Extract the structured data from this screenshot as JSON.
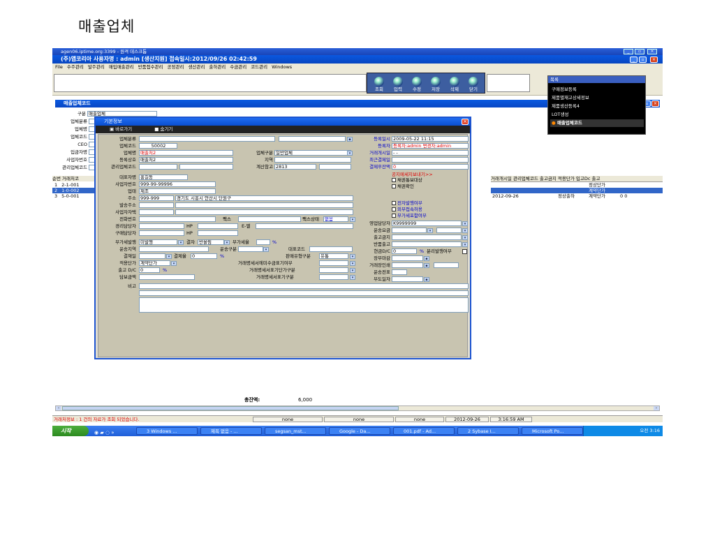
{
  "slide_title": "매출업체",
  "remote_title": "agen06.iptime.org:3399 - 원격 데스크톱",
  "app": {
    "title": "(주)앱코리아  사용자명 : admin [생산지원]   접속일시:2012/09/26  02:42:59",
    "menu": [
      "File",
      "수주관리",
      "발주관리",
      "매입매출관리",
      "반품접수관리",
      "공정관리",
      "생산관리",
      "출하관리",
      "수금관리",
      "코드관리",
      "Windows"
    ],
    "toolbar": [
      "조회",
      "입력",
      "수정",
      "저장",
      "삭제",
      "닫기"
    ]
  },
  "main_window": {
    "title": "매출업체코드",
    "search_label": "구분",
    "search_value": "매출업체",
    "filter_labels": [
      "업체분류",
      "업체명",
      "업체코드",
      "CEO",
      "입금자명",
      "사업자번호",
      "관리업체코드"
    ],
    "grid_header": "순번 거래처코",
    "rows": [
      {
        "no": "1",
        "code": "2-1-001"
      },
      {
        "no": "2",
        "code": "1-0-002"
      },
      {
        "no": "3",
        "code": "5-0-001"
      }
    ],
    "right_headers": "거래개시일 관리업체코드 출고금지   적용단가  입고Dc  출고",
    "right_rows": [
      {
        "date": "",
        "status": "",
        "price": "정상단가",
        "dc": ""
      },
      {
        "date": "",
        "status": "",
        "price": "계약단가",
        "dc": ""
      },
      {
        "date": "2012-09-26",
        "status": "정상출하",
        "price": "계약단가",
        "dc": "0     0"
      }
    ],
    "total_label": "총잔액:",
    "total_value": "6,000"
  },
  "dialog": {
    "title": "기본정보",
    "tools": [
      "바로가기",
      "숨기기"
    ],
    "left_labels": [
      "업체분류",
      "업체코드",
      "업체명",
      "등록상호",
      "관리업체코드",
      "대표자명",
      "사업자번호",
      "업태",
      "주소",
      "발송주소",
      "사업자자택",
      "전화번호",
      "경리담당자",
      "구매담당자",
      "부가세발행",
      "운송지역",
      "결재일",
      "적용단가",
      "출고 D/C",
      "담보금액",
      "비고"
    ],
    "company_code": "50002",
    "company_name": "매출처2",
    "registered_name": "매출처2",
    "ceo": "홍길동",
    "biz_no": "999-99-99996",
    "biz_type": "제조",
    "zip": "999-999",
    "address": "경기도 시흥시 안산시 단원구",
    "company_type_label": "업체구분",
    "company_type": "일반업체",
    "region_label": "지역",
    "tax_ref_label": "계산참고",
    "tax_ref": "2813",
    "payer_label": "입금자명",
    "corp_no_label": "법인번호",
    "item_label": "업종",
    "item": "금형",
    "fax_label": "팩스",
    "fax_status_label": "팩스상태",
    "fax_status": "없음",
    "hp_label": "HP",
    "email_label": "E-멜",
    "vat_issue": "미발행",
    "settle_label": "결자",
    "settle": "반올림",
    "vat_label": "부가세율",
    "percent": "%",
    "ship_type_label": "운송구분",
    "rep_code_label": "대표코드",
    "pay_rate_label": "결제율",
    "pay_rate": "0",
    "sales_channel_label": "판매유형구분",
    "sales_channel": "유통",
    "apply_price": "계약단가",
    "out_dc": "0",
    "tax1_label": "거래명세서에미수금표기여부",
    "tax2_label": "거래명세서표기단가구분",
    "tax3_label": "거래명세서표기구분",
    "reg_date_label": "등록일시",
    "reg_date": "2009-05-22 11:15",
    "registrant_label": "등록자",
    "registrant": "등록자:admin 변경자:admin",
    "trade_start_label": "거래개시일",
    "trade_start": "  -  -",
    "last_trade_label": "최근결제일",
    "balance_label": "결제후잔액",
    "balance": "0",
    "notice": "공지메세지보내기>>",
    "checks_top": [
      "채권통보대상",
      "채권확인"
    ],
    "checks_mid": [
      "전자발행여부",
      "외부접속허용",
      "부가세포함여부"
    ],
    "sales_rep_label": "영업담당자",
    "sales_rep": "K9999999",
    "ship_fee_label": "운송요금",
    "out_ban_label": "출고금지",
    "return_label": "반품출고",
    "cash_dc_label": "현금D/C",
    "cash_dc": "0",
    "split_label": "분리발행여부",
    "deadline_label": "장부마감",
    "trade_stamp_label": "거래장인쇄",
    "ship_slip_label": "운송전표",
    "partner_label": "부도일자"
  },
  "popup": {
    "header": "목록",
    "items": [
      "구매정보등록",
      "제품별재고상세정보",
      "제품생산등록4",
      "LOT생성",
      "매출업체코드"
    ]
  },
  "status": {
    "message": "거래처정보 : 1 건의 자료가 조회 되었습니다.",
    "cells": [
      "none",
      "none",
      "none",
      "2012-09-26",
      "3:16:59 AM"
    ]
  },
  "taskbar": {
    "start": "시작",
    "tasks": [
      "3 Windows ...",
      "제목 없음 - ...",
      "segsan_mst...",
      "Google - Da...",
      "001.pdf - Ad...",
      "2 Sybase I...",
      "Microsoft Po..."
    ],
    "clock": "오전 3:16"
  }
}
